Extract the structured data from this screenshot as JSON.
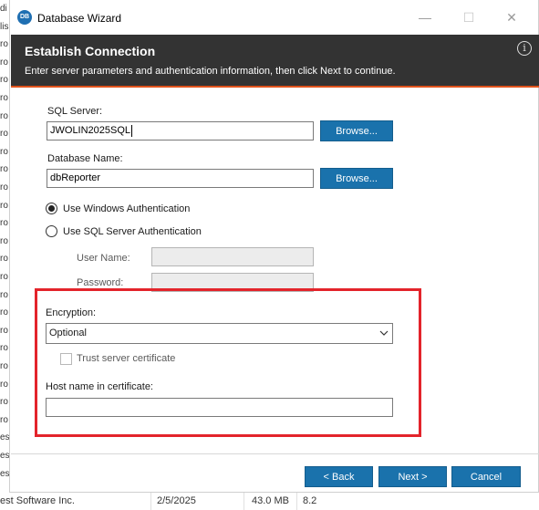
{
  "window": {
    "title": "Database Wizard",
    "app_icon_text": "DB",
    "minimize_glyph": "—",
    "maximize_glyph": "☐",
    "close_glyph": "✕"
  },
  "header": {
    "title": "Establish Connection",
    "subtitle": "Enter server parameters and authentication information, then click Next to continue.",
    "info_glyph": "i"
  },
  "form": {
    "sql_server_label": "SQL Server:",
    "sql_server_value": "JWOLIN2025SQL",
    "browse_label": "Browse...",
    "database_name_label": "Database Name:",
    "database_name_value": "dbReporter",
    "auth_windows_label": "Use Windows Authentication",
    "auth_sql_label": "Use SQL Server Authentication",
    "auth_selected": "windows",
    "user_name_label": "User Name:",
    "user_name_value": "",
    "password_label": "Password:",
    "password_value": "",
    "encryption_label": "Encryption:",
    "encryption_value": "Optional",
    "trust_cert_label": "Trust server certificate",
    "trust_cert_checked": false,
    "host_name_label": "Host name in certificate:",
    "host_name_value": ""
  },
  "footer": {
    "back_label": "< Back",
    "next_label": "Next >",
    "cancel_label": "Cancel"
  },
  "background": {
    "left_fragments": [
      "di",
      "lis",
      "ro",
      "ro",
      "ro",
      "ro",
      "ro",
      "ro",
      "ro",
      "ro",
      "ro",
      "ro",
      "ro",
      "ro",
      "ro",
      "ro",
      "ro",
      "ro",
      "ro",
      "ro",
      "ro",
      "ro",
      "ro",
      "ro",
      "est",
      "est",
      "est"
    ],
    "bottom_row": {
      "publisher": "est Software Inc.",
      "date": "2/5/2025",
      "size": "43.0 MB",
      "version": "8.2"
    }
  },
  "colors": {
    "header_bg": "#333333",
    "header_accent": "#e0521b",
    "button_blue": "#1a72ac",
    "highlight_red": "#e3242b"
  }
}
